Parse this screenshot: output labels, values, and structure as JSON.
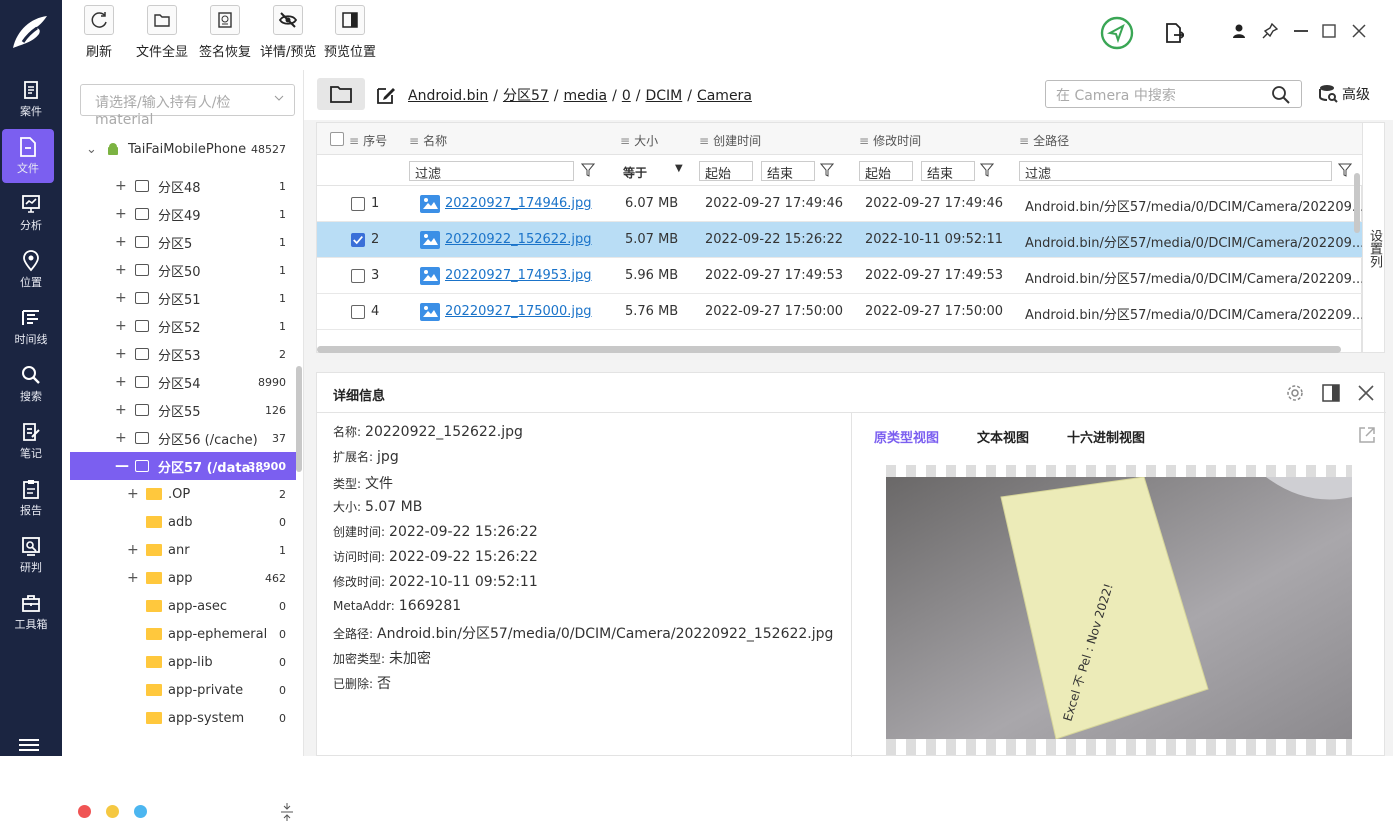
{
  "sidebar": {
    "items": [
      "案件",
      "文件",
      "分析",
      "位置",
      "时间线",
      "搜索",
      "笔记",
      "报告",
      "研判",
      "工具箱"
    ],
    "active": "文件"
  },
  "toolbar": {
    "buttons": [
      "刷新",
      "文件全显",
      "签名恢复",
      "详情/预览",
      "预览位置"
    ]
  },
  "tree": {
    "search_placeholder": "请选择/输入持有人/检material",
    "root": {
      "label": "TaiFaiMobilePhone",
      "count": "48527"
    },
    "rows": [
      {
        "label": "分区48",
        "count": "1"
      },
      {
        "label": "分区49",
        "count": "1"
      },
      {
        "label": "分区5",
        "count": "1"
      },
      {
        "label": "分区50",
        "count": "1"
      },
      {
        "label": "分区51",
        "count": "1"
      },
      {
        "label": "分区52",
        "count": "1"
      },
      {
        "label": "分区53",
        "count": "2"
      },
      {
        "label": "分区54",
        "count": "8990"
      },
      {
        "label": "分区55",
        "count": "126"
      },
      {
        "label": "分区56 (/cache)",
        "count": "37"
      },
      {
        "label": "分区57 (/data...",
        "count": "38900"
      }
    ],
    "folders": [
      {
        "label": ".OP",
        "count": "2",
        "plus": true
      },
      {
        "label": "adb",
        "count": "0",
        "plus": false
      },
      {
        "label": "anr",
        "count": "1",
        "plus": true
      },
      {
        "label": "app",
        "count": "462",
        "plus": true
      },
      {
        "label": "app-asec",
        "count": "0",
        "plus": false
      },
      {
        "label": "app-ephemeral",
        "count": "0",
        "plus": false
      },
      {
        "label": "app-lib",
        "count": "0",
        "plus": false
      },
      {
        "label": "app-private",
        "count": "0",
        "plus": false
      },
      {
        "label": "app-system",
        "count": "0",
        "plus": false
      }
    ]
  },
  "breadcrumb": [
    "Android.bin",
    "分区57",
    "media",
    "0",
    "DCIM",
    "Camera"
  ],
  "search": {
    "placeholder": "在 Camera 中搜索",
    "advanced": "高级"
  },
  "grid": {
    "headers": {
      "index": "序号",
      "name": "名称",
      "size": "大小",
      "created": "创建时间",
      "modified": "修改时间",
      "path": "全路径"
    },
    "filters": {
      "name": "过滤",
      "size_op": "等于",
      "c_start": "起始",
      "c_end": "结束",
      "m_start": "起始",
      "m_end": "结束",
      "path": "过滤"
    },
    "rows": [
      {
        "idx": "1",
        "name": "20220927_174946.jpg",
        "size": "6.07 MB",
        "created": "2022-09-27 17:49:46",
        "modified": "2022-09-27 17:49:46",
        "path": "Android.bin/分区57/media/0/DCIM/Camera/202209..."
      },
      {
        "idx": "2",
        "name": "20220922_152622.jpg",
        "size": "5.07 MB",
        "created": "2022-09-22 15:26:22",
        "modified": "2022-10-11 09:52:11",
        "path": "Android.bin/分区57/media/0/DCIM/Camera/202209..."
      },
      {
        "idx": "3",
        "name": "20220927_174953.jpg",
        "size": "5.96 MB",
        "created": "2022-09-27 17:49:53",
        "modified": "2022-09-27 17:49:53",
        "path": "Android.bin/分区57/media/0/DCIM/Camera/202209..."
      },
      {
        "idx": "4",
        "name": "20220927_175000.jpg",
        "size": "5.76 MB",
        "created": "2022-09-27 17:50:00",
        "modified": "2022-09-27 17:50:00",
        "path": "Android.bin/分区57/media/0/DCIM/Camera/202209..."
      }
    ],
    "column_settings": "设置列"
  },
  "detail": {
    "title": "详细信息",
    "props": [
      {
        "k": "名称:",
        "v": "20220922_152622.jpg"
      },
      {
        "k": "扩展名:",
        "v": "jpg"
      },
      {
        "k": "类型:",
        "v": "文件"
      },
      {
        "k": "大小:",
        "v": "5.07 MB"
      },
      {
        "k": "创建时间:",
        "v": "2022-09-22 15:26:22"
      },
      {
        "k": "访问时间:",
        "v": "2022-09-22 15:26:22"
      },
      {
        "k": "修改时间:",
        "v": "2022-10-11 09:52:11"
      },
      {
        "k": "MetaAddr:",
        "v": "1669281"
      },
      {
        "k": "全路径:",
        "v": "Android.bin/分区57/media/0/DCIM/Camera/20220922_152622.jpg"
      },
      {
        "k": "加密类型:",
        "v": "未加密"
      },
      {
        "k": "已删除:",
        "v": "否"
      }
    ],
    "tabs": [
      "原类型视图",
      "文本视图",
      "十六进制视图"
    ],
    "photo_text": "Excel 不 Pel : Nov 2022!"
  }
}
